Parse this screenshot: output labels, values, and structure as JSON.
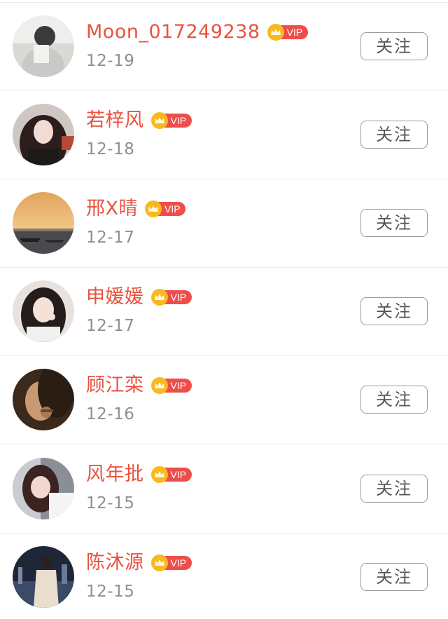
{
  "badge": {
    "label": "VIP",
    "icon": "crown-icon"
  },
  "colors": {
    "name": "#e8533f",
    "vip_pill": "#ee4e4a",
    "crown": "#f8b91e",
    "date": "#8f8f8f",
    "button_border": "#9a9a9a"
  },
  "users": [
    {
      "name": "Moon_017249238",
      "date": "12-19",
      "follow_label": "关注"
    },
    {
      "name": "若梓风",
      "date": "12-18",
      "follow_label": "关注"
    },
    {
      "name": "邢X晴",
      "date": "12-17",
      "follow_label": "关注"
    },
    {
      "name": "申媛媛",
      "date": "12-17",
      "follow_label": "关注"
    },
    {
      "name": "顾江栾",
      "date": "12-16",
      "follow_label": "关注"
    },
    {
      "name": "风年批",
      "date": "12-15",
      "follow_label": "关注"
    },
    {
      "name": "陈沐源",
      "date": "12-15",
      "follow_label": "关注"
    }
  ]
}
